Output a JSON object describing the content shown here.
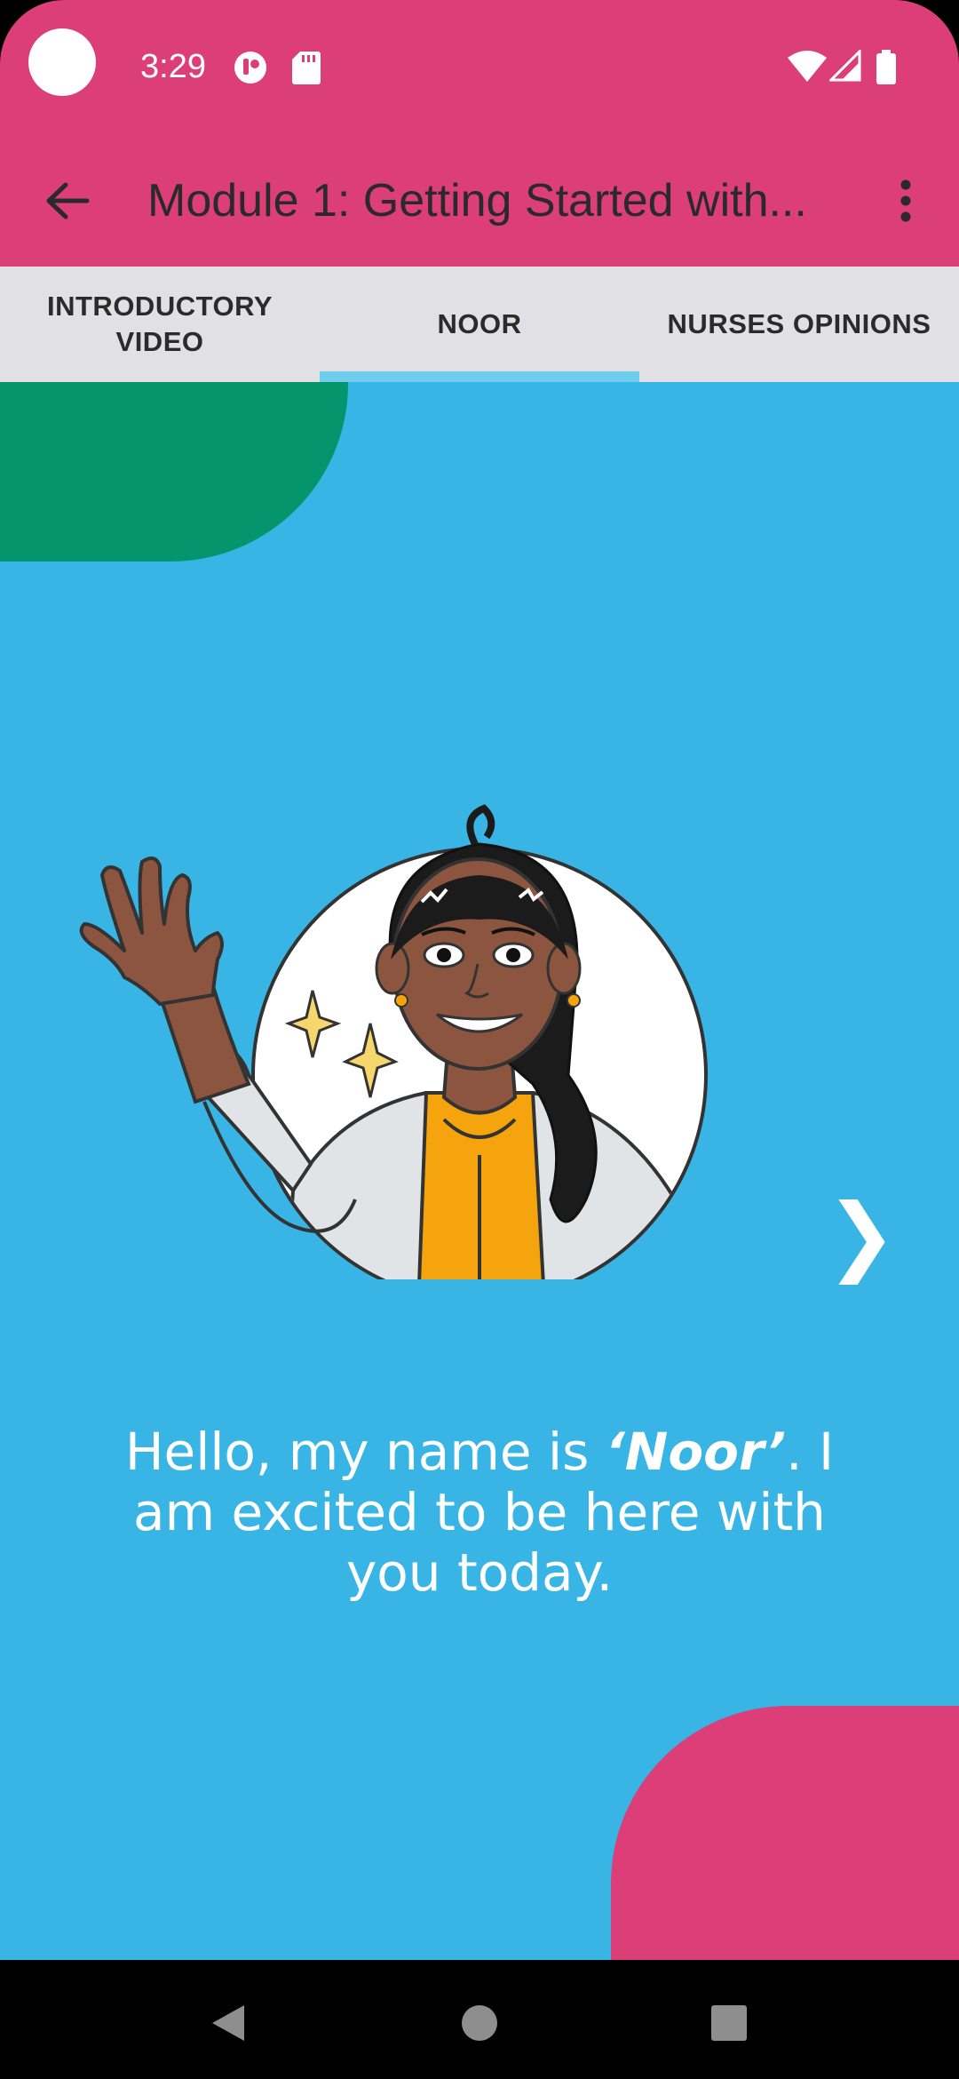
{
  "status_bar": {
    "time": "3:29",
    "icons": [
      "camera-cutout",
      "app-notification-icon",
      "sd-card-icon",
      "wifi-icon",
      "signal-icon",
      "battery-icon"
    ]
  },
  "app_bar": {
    "title": "Module 1: Getting Started with...",
    "back_icon": "arrow-left-icon",
    "more_icon": "more-vert-icon",
    "background_color": "#dc3e78"
  },
  "tabs": [
    {
      "label": "INTRODUCTORY VIDEO",
      "active": false
    },
    {
      "label": "NOOR",
      "active": true
    },
    {
      "label": "NURSES OPINIONS",
      "active": false
    }
  ],
  "slide": {
    "background_color": "#39b5e5",
    "message_prefix": "Hello, my name is ",
    "message_name": "‘Noor’",
    "message_suffix": ". I am excited to be here with you today.",
    "next_glyph": "❯",
    "illustration": "waving-woman-illustration"
  },
  "nav_bar": {
    "icons": [
      "back-triangle-icon",
      "home-circle-icon",
      "recents-square-icon"
    ]
  }
}
